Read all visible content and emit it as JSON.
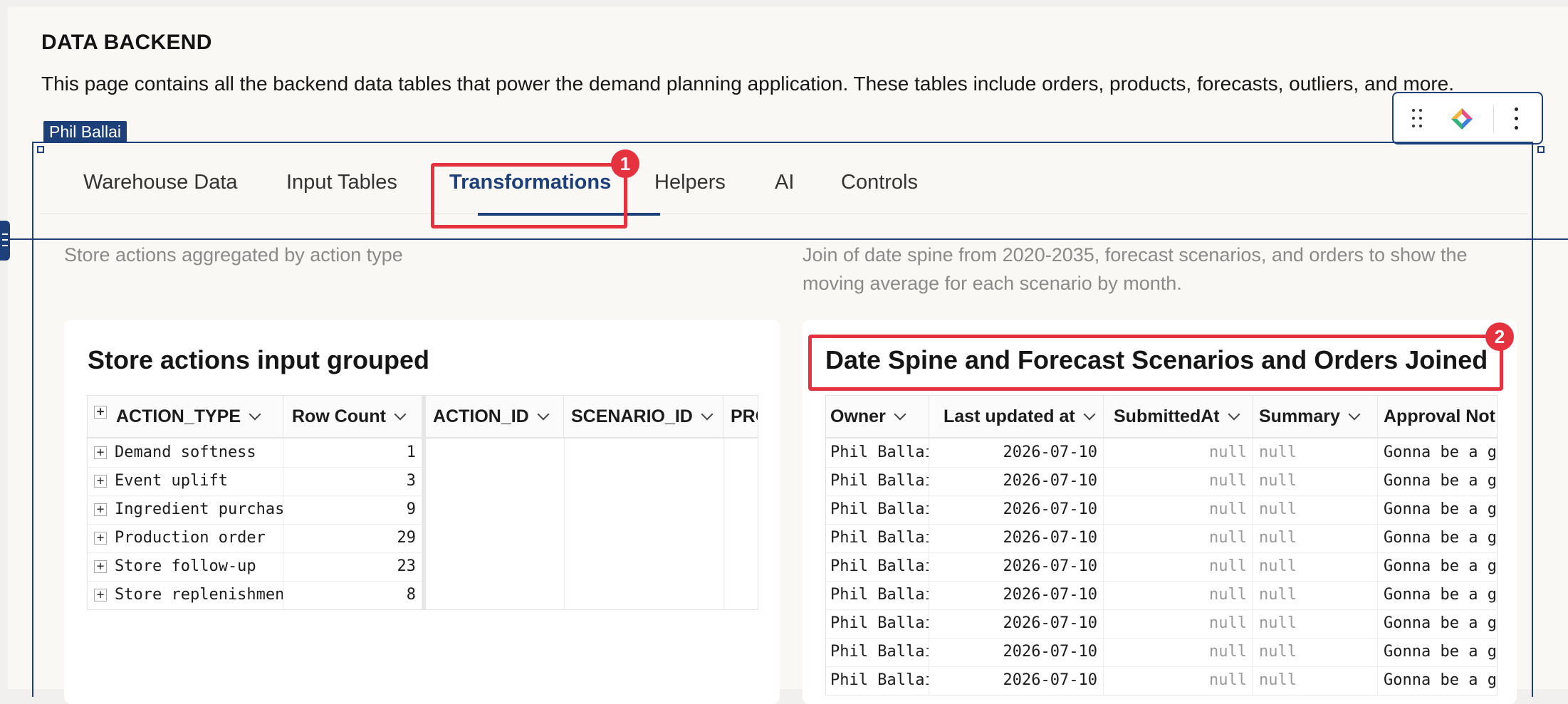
{
  "page": {
    "title": "DATA BACKEND",
    "description": "This page contains all the backend data tables that power the demand planning application. These tables include orders, products, forecasts, outliers, and more.",
    "owner_badge": "Phil Ballai"
  },
  "tabs": [
    {
      "label": "Warehouse Data"
    },
    {
      "label": "Input Tables"
    },
    {
      "label": "Transformations"
    },
    {
      "label": "Helpers"
    },
    {
      "label": "AI"
    },
    {
      "label": "Controls"
    }
  ],
  "active_tab": "Transformations",
  "callouts": [
    "1",
    "2"
  ],
  "colors": {
    "accent": "#1d3f7a",
    "highlight": "#e5323f"
  },
  "left_section": {
    "description": "Store actions aggregated by action type",
    "card_title": "Store actions input grouped",
    "columns": [
      "ACTION_TYPE",
      "Row Count",
      "ACTION_ID",
      "SCENARIO_ID",
      "PRO"
    ],
    "rows": [
      {
        "action_type": "Demand softness",
        "count": "1"
      },
      {
        "action_type": "Event uplift",
        "count": "3"
      },
      {
        "action_type": "Ingredient purchase",
        "count": "9"
      },
      {
        "action_type": "Production order",
        "count": "29"
      },
      {
        "action_type": "Store follow-up",
        "count": "23"
      },
      {
        "action_type": "Store replenishment",
        "count": "8"
      }
    ]
  },
  "right_section": {
    "description": "Join of date spine from 2020-2035, forecast scenarios, and orders to show the moving average for each scenario by month.",
    "card_title": "Date Spine and Forecast Scenarios and Orders Joined",
    "columns": [
      "Owner",
      "Last updated at",
      "SubmittedAt",
      "Summary",
      "Approval Not"
    ],
    "rows": [
      {
        "owner": "Phil Ballai",
        "updated": "2026-07-10",
        "submitted": "null",
        "summary": "null",
        "approval": "Gonna be a gr"
      },
      {
        "owner": "Phil Ballai",
        "updated": "2026-07-10",
        "submitted": "null",
        "summary": "null",
        "approval": "Gonna be a gr"
      },
      {
        "owner": "Phil Ballai",
        "updated": "2026-07-10",
        "submitted": "null",
        "summary": "null",
        "approval": "Gonna be a gr"
      },
      {
        "owner": "Phil Ballai",
        "updated": "2026-07-10",
        "submitted": "null",
        "summary": "null",
        "approval": "Gonna be a gr"
      },
      {
        "owner": "Phil Ballai",
        "updated": "2026-07-10",
        "submitted": "null",
        "summary": "null",
        "approval": "Gonna be a gr"
      },
      {
        "owner": "Phil Ballai",
        "updated": "2026-07-10",
        "submitted": "null",
        "summary": "null",
        "approval": "Gonna be a gr"
      },
      {
        "owner": "Phil Ballai",
        "updated": "2026-07-10",
        "submitted": "null",
        "summary": "null",
        "approval": "Gonna be a gr"
      },
      {
        "owner": "Phil Ballai",
        "updated": "2026-07-10",
        "submitted": "null",
        "summary": "null",
        "approval": "Gonna be a gr"
      },
      {
        "owner": "Phil Ballai",
        "updated": "2026-07-10",
        "submitted": "null",
        "summary": "null",
        "approval": "Gonna be a gr"
      }
    ]
  },
  "icons": [
    "drag-handle-icon",
    "ai-assistant-icon",
    "more-options-icon",
    "expand-plus-icon",
    "chevron-down-icon",
    "panel-handle-icon"
  ]
}
